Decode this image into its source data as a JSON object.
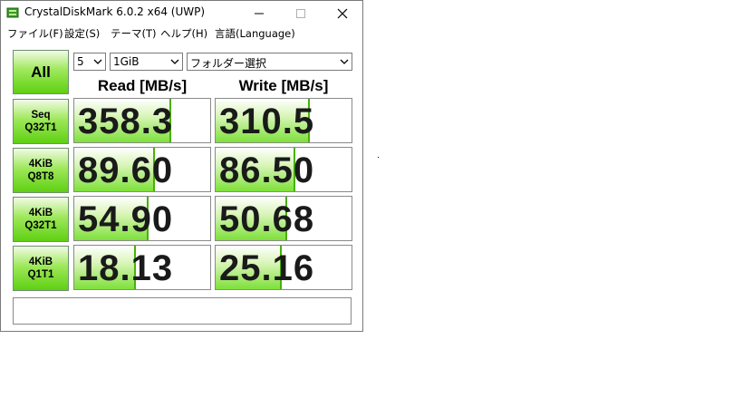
{
  "window": {
    "title": "CrystalDiskMark 6.0.2 x64 (UWP)"
  },
  "menu": [
    "ファイル(F)",
    "設定(S)",
    "テーマ(T)",
    "ヘルプ(H)",
    "言語(Language)"
  ],
  "controls": {
    "all_label": "All",
    "count": "5",
    "size": "1GiB",
    "folder": "フォルダー選択"
  },
  "headers": {
    "read": "Read [MB/s]",
    "write": "Write [MB/s]"
  },
  "tests": [
    {
      "line1": "Seq",
      "line2": "Q32T1",
      "read": "358.3",
      "write": "310.5",
      "read_fill": 0.7,
      "write_fill": 0.68
    },
    {
      "line1": "4KiB",
      "line2": "Q8T8",
      "read": "89.60",
      "write": "86.50",
      "read_fill": 0.58,
      "write_fill": 0.57
    },
    {
      "line1": "4KiB",
      "line2": "Q32T1",
      "read": "54.90",
      "write": "50.68",
      "read_fill": 0.53,
      "write_fill": 0.51
    },
    {
      "line1": "4KiB",
      "line2": "Q1T1",
      "read": "18.13",
      "write": "25.16",
      "read_fill": 0.44,
      "write_fill": 0.47
    }
  ],
  "status_text": "",
  "colors": {
    "accent_green": "#5fd012",
    "bar_edge": "#4ab00a"
  }
}
